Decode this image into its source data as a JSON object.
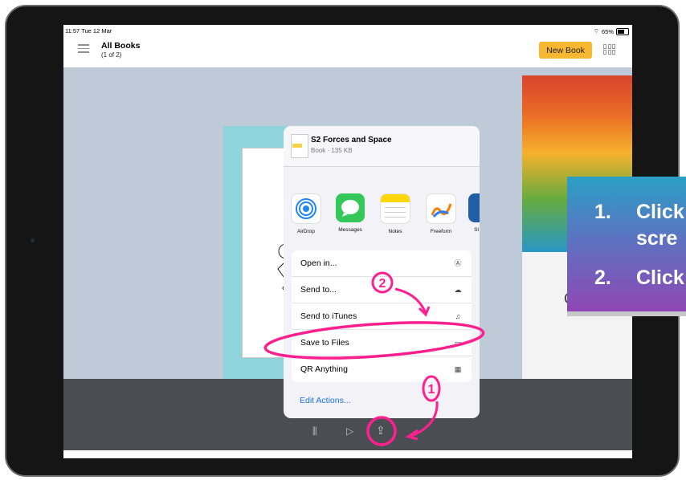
{
  "status_bar": {
    "time": "11:57  Tue 12 Mar",
    "battery": "65%"
  },
  "header": {
    "title": "All Books",
    "subtitle": "(1 of 2)",
    "new_book_label": "New Book"
  },
  "share_sheet": {
    "doc_title": "S2 Forces and Space",
    "doc_meta": "Book · 135 KB",
    "apps": [
      {
        "label": "AirDrop",
        "icon": "airdrop-icon",
        "color": "#1e86f5"
      },
      {
        "label": "Messages",
        "icon": "messages-icon",
        "color": "#34c759"
      },
      {
        "label": "Notes",
        "icon": "notes-icon",
        "color": "#ffd60a"
      },
      {
        "label": "Freeform",
        "icon": "freeform-icon",
        "color": "#ffffff"
      },
      {
        "label": "Sl",
        "icon": "app-icon",
        "color": "#1f5fa8"
      }
    ],
    "actions": [
      {
        "label": "Open in...",
        "icon": "open-in-icon"
      },
      {
        "label": "Send to...",
        "icon": "cloud-icon"
      },
      {
        "label": "Send to iTunes",
        "icon": "music-icon"
      },
      {
        "label": "Save to Files",
        "icon": "folder-icon"
      },
      {
        "label": "QR Anything",
        "icon": "qr-icon"
      }
    ],
    "edit_actions_label": "Edit Actions..."
  },
  "book_right": {
    "visible_text": "G"
  },
  "instructions": {
    "items": [
      {
        "number": "1.",
        "text_line1": "Click",
        "text_line2": "scre"
      },
      {
        "number": "2.",
        "text_line1": "Click"
      }
    ]
  },
  "annotations": {
    "step1_number": "1",
    "step2_number": "2",
    "color": "#ff1f8f"
  },
  "colors": {
    "accent": "#f7b731",
    "link": "#1a73e8",
    "annotation": "#ff1f8f"
  }
}
